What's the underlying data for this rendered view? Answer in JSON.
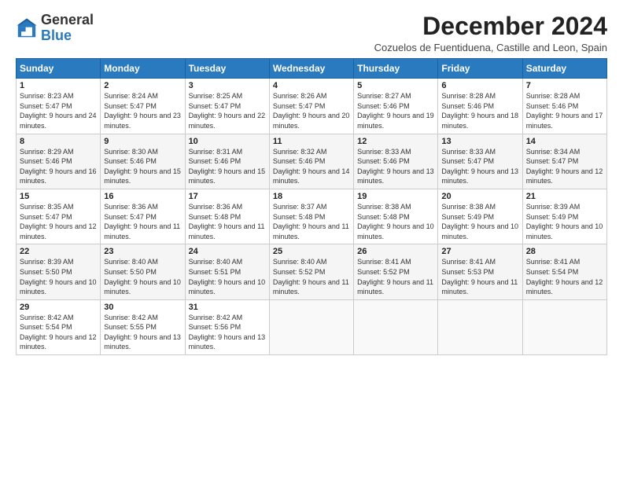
{
  "logo": {
    "line1": "General",
    "line2": "Blue"
  },
  "title": "December 2024",
  "subtitle": "Cozuelos de Fuentiduena, Castille and Leon, Spain",
  "header_days": [
    "Sunday",
    "Monday",
    "Tuesday",
    "Wednesday",
    "Thursday",
    "Friday",
    "Saturday"
  ],
  "weeks": [
    [
      {
        "day": "1",
        "sunrise": "Sunrise: 8:23 AM",
        "sunset": "Sunset: 5:47 PM",
        "daylight": "Daylight: 9 hours and 24 minutes."
      },
      {
        "day": "2",
        "sunrise": "Sunrise: 8:24 AM",
        "sunset": "Sunset: 5:47 PM",
        "daylight": "Daylight: 9 hours and 23 minutes."
      },
      {
        "day": "3",
        "sunrise": "Sunrise: 8:25 AM",
        "sunset": "Sunset: 5:47 PM",
        "daylight": "Daylight: 9 hours and 22 minutes."
      },
      {
        "day": "4",
        "sunrise": "Sunrise: 8:26 AM",
        "sunset": "Sunset: 5:47 PM",
        "daylight": "Daylight: 9 hours and 20 minutes."
      },
      {
        "day": "5",
        "sunrise": "Sunrise: 8:27 AM",
        "sunset": "Sunset: 5:46 PM",
        "daylight": "Daylight: 9 hours and 19 minutes."
      },
      {
        "day": "6",
        "sunrise": "Sunrise: 8:28 AM",
        "sunset": "Sunset: 5:46 PM",
        "daylight": "Daylight: 9 hours and 18 minutes."
      },
      {
        "day": "7",
        "sunrise": "Sunrise: 8:28 AM",
        "sunset": "Sunset: 5:46 PM",
        "daylight": "Daylight: 9 hours and 17 minutes."
      }
    ],
    [
      {
        "day": "8",
        "sunrise": "Sunrise: 8:29 AM",
        "sunset": "Sunset: 5:46 PM",
        "daylight": "Daylight: 9 hours and 16 minutes."
      },
      {
        "day": "9",
        "sunrise": "Sunrise: 8:30 AM",
        "sunset": "Sunset: 5:46 PM",
        "daylight": "Daylight: 9 hours and 15 minutes."
      },
      {
        "day": "10",
        "sunrise": "Sunrise: 8:31 AM",
        "sunset": "Sunset: 5:46 PM",
        "daylight": "Daylight: 9 hours and 15 minutes."
      },
      {
        "day": "11",
        "sunrise": "Sunrise: 8:32 AM",
        "sunset": "Sunset: 5:46 PM",
        "daylight": "Daylight: 9 hours and 14 minutes."
      },
      {
        "day": "12",
        "sunrise": "Sunrise: 8:33 AM",
        "sunset": "Sunset: 5:46 PM",
        "daylight": "Daylight: 9 hours and 13 minutes."
      },
      {
        "day": "13",
        "sunrise": "Sunrise: 8:33 AM",
        "sunset": "Sunset: 5:47 PM",
        "daylight": "Daylight: 9 hours and 13 minutes."
      },
      {
        "day": "14",
        "sunrise": "Sunrise: 8:34 AM",
        "sunset": "Sunset: 5:47 PM",
        "daylight": "Daylight: 9 hours and 12 minutes."
      }
    ],
    [
      {
        "day": "15",
        "sunrise": "Sunrise: 8:35 AM",
        "sunset": "Sunset: 5:47 PM",
        "daylight": "Daylight: 9 hours and 12 minutes."
      },
      {
        "day": "16",
        "sunrise": "Sunrise: 8:36 AM",
        "sunset": "Sunset: 5:47 PM",
        "daylight": "Daylight: 9 hours and 11 minutes."
      },
      {
        "day": "17",
        "sunrise": "Sunrise: 8:36 AM",
        "sunset": "Sunset: 5:48 PM",
        "daylight": "Daylight: 9 hours and 11 minutes."
      },
      {
        "day": "18",
        "sunrise": "Sunrise: 8:37 AM",
        "sunset": "Sunset: 5:48 PM",
        "daylight": "Daylight: 9 hours and 11 minutes."
      },
      {
        "day": "19",
        "sunrise": "Sunrise: 8:38 AM",
        "sunset": "Sunset: 5:48 PM",
        "daylight": "Daylight: 9 hours and 10 minutes."
      },
      {
        "day": "20",
        "sunrise": "Sunrise: 8:38 AM",
        "sunset": "Sunset: 5:49 PM",
        "daylight": "Daylight: 9 hours and 10 minutes."
      },
      {
        "day": "21",
        "sunrise": "Sunrise: 8:39 AM",
        "sunset": "Sunset: 5:49 PM",
        "daylight": "Daylight: 9 hours and 10 minutes."
      }
    ],
    [
      {
        "day": "22",
        "sunrise": "Sunrise: 8:39 AM",
        "sunset": "Sunset: 5:50 PM",
        "daylight": "Daylight: 9 hours and 10 minutes."
      },
      {
        "day": "23",
        "sunrise": "Sunrise: 8:40 AM",
        "sunset": "Sunset: 5:50 PM",
        "daylight": "Daylight: 9 hours and 10 minutes."
      },
      {
        "day": "24",
        "sunrise": "Sunrise: 8:40 AM",
        "sunset": "Sunset: 5:51 PM",
        "daylight": "Daylight: 9 hours and 10 minutes."
      },
      {
        "day": "25",
        "sunrise": "Sunrise: 8:40 AM",
        "sunset": "Sunset: 5:52 PM",
        "daylight": "Daylight: 9 hours and 11 minutes."
      },
      {
        "day": "26",
        "sunrise": "Sunrise: 8:41 AM",
        "sunset": "Sunset: 5:52 PM",
        "daylight": "Daylight: 9 hours and 11 minutes."
      },
      {
        "day": "27",
        "sunrise": "Sunrise: 8:41 AM",
        "sunset": "Sunset: 5:53 PM",
        "daylight": "Daylight: 9 hours and 11 minutes."
      },
      {
        "day": "28",
        "sunrise": "Sunrise: 8:41 AM",
        "sunset": "Sunset: 5:54 PM",
        "daylight": "Daylight: 9 hours and 12 minutes."
      }
    ],
    [
      {
        "day": "29",
        "sunrise": "Sunrise: 8:42 AM",
        "sunset": "Sunset: 5:54 PM",
        "daylight": "Daylight: 9 hours and 12 minutes."
      },
      {
        "day": "30",
        "sunrise": "Sunrise: 8:42 AM",
        "sunset": "Sunset: 5:55 PM",
        "daylight": "Daylight: 9 hours and 13 minutes."
      },
      {
        "day": "31",
        "sunrise": "Sunrise: 8:42 AM",
        "sunset": "Sunset: 5:56 PM",
        "daylight": "Daylight: 9 hours and 13 minutes."
      },
      null,
      null,
      null,
      null
    ]
  ]
}
